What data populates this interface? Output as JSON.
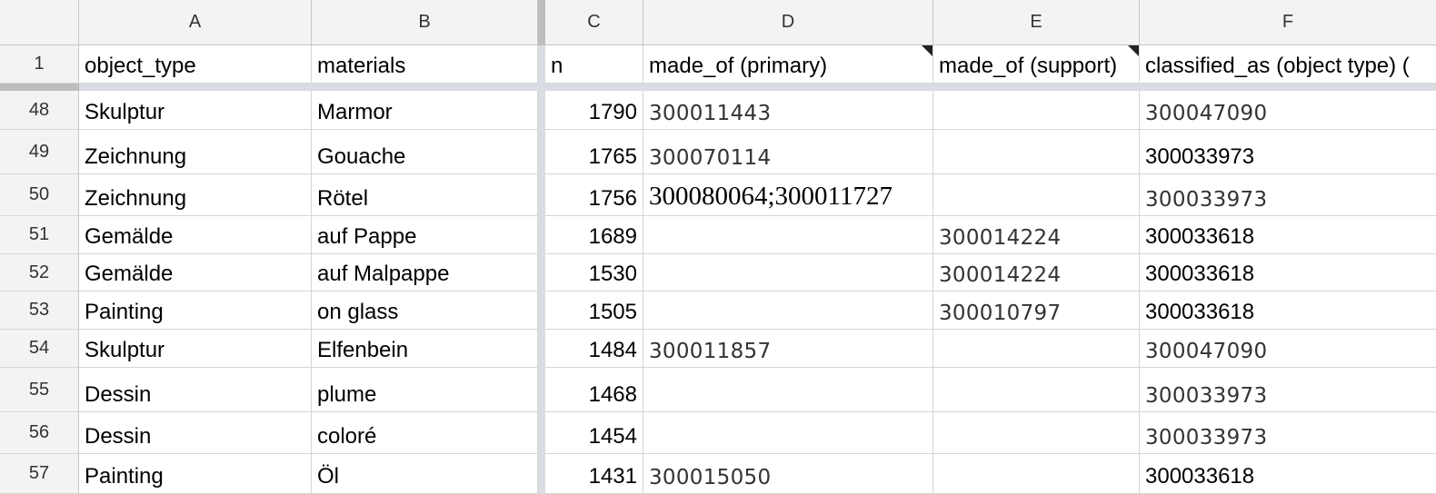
{
  "columns": [
    "A",
    "B",
    "C",
    "D",
    "E",
    "F"
  ],
  "header_row": {
    "row_number": "1",
    "cells": [
      "object_type",
      "materials",
      "n",
      "made_of (primary)",
      "made_of (support)",
      "classified_as (object type) ("
    ]
  },
  "rows": [
    {
      "row_number": "48",
      "object_type": "Skulptur",
      "materials": "Marmor",
      "n": "1790",
      "made_of_primary": "300011443",
      "made_of_support": "",
      "classified_as": "300047090"
    },
    {
      "row_number": "49",
      "object_type": "Zeichnung",
      "materials": "Gouache",
      "n": "1765",
      "made_of_primary": "300070114",
      "made_of_support": "",
      "classified_as": "300033973"
    },
    {
      "row_number": "50",
      "object_type": "Zeichnung",
      "materials": "Rötel",
      "n": "1756",
      "made_of_primary": "300080064;300011727",
      "made_of_support": "",
      "classified_as": "300033973"
    },
    {
      "row_number": "51",
      "object_type": "Gemälde",
      "materials": "auf Pappe",
      "n": "1689",
      "made_of_primary": "",
      "made_of_support": "300014224",
      "classified_as": "300033618"
    },
    {
      "row_number": "52",
      "object_type": "Gemälde",
      "materials": "auf Malpappe",
      "n": "1530",
      "made_of_primary": "",
      "made_of_support": "300014224",
      "classified_as": "300033618"
    },
    {
      "row_number": "53",
      "object_type": "Painting",
      "materials": "on glass",
      "n": "1505",
      "made_of_primary": "",
      "made_of_support": "300010797",
      "classified_as": "300033618"
    },
    {
      "row_number": "54",
      "object_type": "Skulptur",
      "materials": "Elfenbein",
      "n": "1484",
      "made_of_primary": "300011857",
      "made_of_support": "",
      "classified_as": "300047090"
    },
    {
      "row_number": "55",
      "object_type": "Dessin",
      "materials": "plume",
      "n": "1468",
      "made_of_primary": "",
      "made_of_support": "",
      "classified_as": "300033973"
    },
    {
      "row_number": "56",
      "object_type": "Dessin",
      "materials": "coloré",
      "n": "1454",
      "made_of_primary": "",
      "made_of_support": "",
      "classified_as": "300033973"
    },
    {
      "row_number": "57",
      "object_type": "Painting",
      "materials": "Öl",
      "n": "1431",
      "made_of_primary": "300015050",
      "made_of_support": "",
      "classified_as": "300033618"
    }
  ]
}
